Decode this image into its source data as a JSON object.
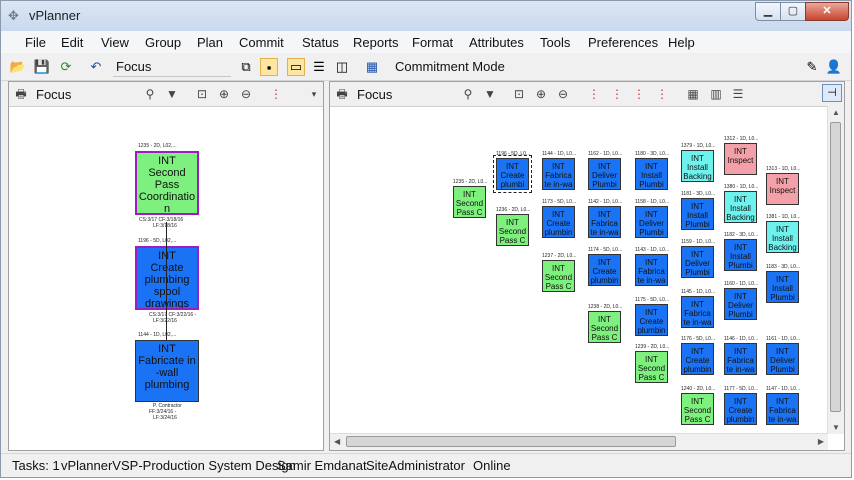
{
  "window": {
    "title": "vPlanner"
  },
  "menu": [
    "File",
    "Edit",
    "View",
    "Group",
    "Plan",
    "Commit",
    "Status",
    "Reports",
    "Format",
    "Attributes",
    "Tools",
    "Preferences",
    "Help"
  ],
  "toolbar": {
    "focus_label": "Focus",
    "mode_label": "Commitment Mode"
  },
  "left_pane": {
    "title": "Focus",
    "tasks": [
      {
        "header": "1235 - 2D, L02,...",
        "lines": [
          "INT",
          "Second",
          "Pass",
          "Coordinatio",
          "n"
        ],
        "footer": [
          "CS:3/17 CF:3/18/16",
          "LF:3/18/16"
        ],
        "color": "green"
      },
      {
        "header": "1196 - 5D, L02,...",
        "lines": [
          "INT",
          "Create",
          "plumbing",
          "spool",
          "drawings"
        ],
        "footer": [
          "CS:3/17 CF:3/22/16 -",
          "LF:3/22/16"
        ],
        "color": "blue"
      },
      {
        "header": "1144 - 1D, L02,...",
        "lines": [
          "INT",
          "Fabricate in",
          "-wall",
          "plumbing"
        ],
        "footer": [
          "P. Contractor",
          "FF:3/24/16 -",
          "LF:3/24/16"
        ],
        "color": "blue"
      }
    ]
  },
  "right_pane": {
    "title": "Focus",
    "tasks": [
      {
        "header": "1235 - 2D, L0...",
        "lines": [
          "INT",
          "Second",
          "Pass C"
        ],
        "color": "green"
      },
      {
        "header": "1196 - 5D, L0...",
        "lines": [
          "INT",
          "Create",
          "plumbi"
        ],
        "color": "blue",
        "selected": true
      },
      {
        "header": "1144 - 1D, L0...",
        "lines": [
          "INT",
          "Fabrica",
          "te in-wa"
        ],
        "color": "blue"
      },
      {
        "header": "1162 - 1D, L0...",
        "lines": [
          "INT",
          "Deliver",
          "Plumbi"
        ],
        "color": "blue"
      },
      {
        "header": "1180 - 3D, L0...",
        "lines": [
          "INT",
          "Install",
          "Plumbi"
        ],
        "color": "blue"
      },
      {
        "header": "1379 - 1D, L0...",
        "lines": [
          "INT",
          "Install",
          "Backing"
        ],
        "color": "cyan"
      },
      {
        "header": "1312 - 1D, L0...",
        "lines": [
          "INT",
          "Inspect"
        ],
        "color": "pink"
      },
      {
        "header": "1236 - 2D, L0...",
        "lines": [
          "INT",
          "Second",
          "Pass C"
        ],
        "color": "green"
      },
      {
        "header": "1173 - 5D, L0...",
        "lines": [
          "INT",
          "Create",
          "plumbin"
        ],
        "color": "blue"
      },
      {
        "header": "1142 - 1D, L0...",
        "lines": [
          "INT",
          "Fabrica",
          "te in-wa"
        ],
        "color": "blue"
      },
      {
        "header": "1158 - 1D, L0...",
        "lines": [
          "INT",
          "Deliver",
          "Plumbi"
        ],
        "color": "blue"
      },
      {
        "header": "1181 - 3D, L0...",
        "lines": [
          "INT",
          "Install",
          "Plumbi"
        ],
        "color": "blue"
      },
      {
        "header": "1380 - 1D, L0...",
        "lines": [
          "INT",
          "Install",
          "Backing"
        ],
        "color": "cyan"
      },
      {
        "header": "1313 - 1D, L0...",
        "lines": [
          "INT",
          "Inspect"
        ],
        "color": "pink"
      },
      {
        "header": "1237 - 2D, L0...",
        "lines": [
          "INT",
          "Second",
          "Pass C"
        ],
        "color": "green"
      },
      {
        "header": "1174 - 5D, L0...",
        "lines": [
          "INT",
          "Create",
          "plumbin"
        ],
        "color": "blue"
      },
      {
        "header": "1143 - 1D, L0...",
        "lines": [
          "INT",
          "Fabrica",
          "te in-wa"
        ],
        "color": "blue"
      },
      {
        "header": "1159 - 1D, L0...",
        "lines": [
          "INT",
          "Deliver",
          "Plumbi"
        ],
        "color": "blue"
      },
      {
        "header": "1182 - 3D, L0...",
        "lines": [
          "INT",
          "Install",
          "Plumbi"
        ],
        "color": "blue"
      },
      {
        "header": "1381 - 1D, L0...",
        "lines": [
          "INT",
          "Install",
          "Backing"
        ],
        "color": "cyan"
      },
      {
        "header": "1238 - 2D, L0...",
        "lines": [
          "INT",
          "Second",
          "Pass C"
        ],
        "color": "green"
      },
      {
        "header": "1175 - 5D, L0...",
        "lines": [
          "INT",
          "Create",
          "plumbin"
        ],
        "color": "blue"
      },
      {
        "header": "1145 - 1D, L0...",
        "lines": [
          "INT",
          "Fabrica",
          "te in-wa"
        ],
        "color": "blue"
      },
      {
        "header": "1160 - 1D, L0...",
        "lines": [
          "INT",
          "Deliver",
          "Plumbi"
        ],
        "color": "blue"
      },
      {
        "header": "1183 - 3D, L0...",
        "lines": [
          "INT",
          "Install",
          "Plumbi"
        ],
        "color": "blue"
      },
      {
        "header": "1239 - 2D, L0...",
        "lines": [
          "INT",
          "Second",
          "Pass C"
        ],
        "color": "green"
      },
      {
        "header": "1176 - 5D, L0...",
        "lines": [
          "INT",
          "Create",
          "plumbin"
        ],
        "color": "blue"
      },
      {
        "header": "1146 - 1D, L0...",
        "lines": [
          "INT",
          "Fabrica",
          "te in-wa"
        ],
        "color": "blue"
      },
      {
        "header": "1161 - 1D, L0...",
        "lines": [
          "INT",
          "Deliver",
          "Plumbi"
        ],
        "color": "blue"
      },
      {
        "header": "1240 - 2D, L0...",
        "lines": [
          "INT",
          "Second",
          "Pass C"
        ],
        "color": "green"
      },
      {
        "header": "1177 - 5D, L0...",
        "lines": [
          "INT",
          "Create",
          "plumbin"
        ],
        "color": "blue"
      },
      {
        "header": "1147 - 1D, L0...",
        "lines": [
          "INT",
          "Fabrica",
          "te in-wa"
        ],
        "color": "blue"
      }
    ]
  },
  "status": {
    "tasks": "Tasks: 1",
    "project": "vPlannerVSP-Production System Design",
    "user": "Samir Emdanat",
    "role": "SiteAdministrator",
    "connection": "Online"
  },
  "colors": {
    "green": "#7ef07e",
    "blue": "#1a73f5",
    "cyan": "#6ef2ee",
    "pink": "#f4a0a8"
  }
}
